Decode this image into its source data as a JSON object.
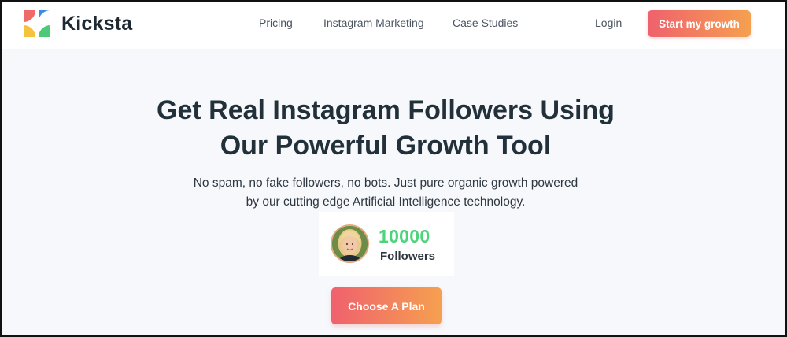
{
  "brand": {
    "name": "Kicksta",
    "logo_icon": "kicksta-logo-icon"
  },
  "nav": {
    "links": [
      "Pricing",
      "Instagram Marketing",
      "Case Studies"
    ],
    "login": "Login",
    "cta": "Start my growth"
  },
  "hero": {
    "title_line1": "Get Real Instagram Followers Using",
    "title_line2": "Our Powerful Growth Tool",
    "subtitle_line1": "No spam, no fake followers, no bots. Just pure organic growth powered",
    "subtitle_line2": "by our cutting edge Artificial Intelligence technology."
  },
  "stat": {
    "value": "10000",
    "label": "Followers",
    "avatar_icon": "user-avatar"
  },
  "cta": {
    "label": "Choose A Plan"
  },
  "colors": {
    "accent_start": "#f0616d",
    "accent_end": "#f5a050",
    "followers_green": "#4cd47b",
    "heading": "#22303a",
    "background": "#f6f8fc"
  }
}
